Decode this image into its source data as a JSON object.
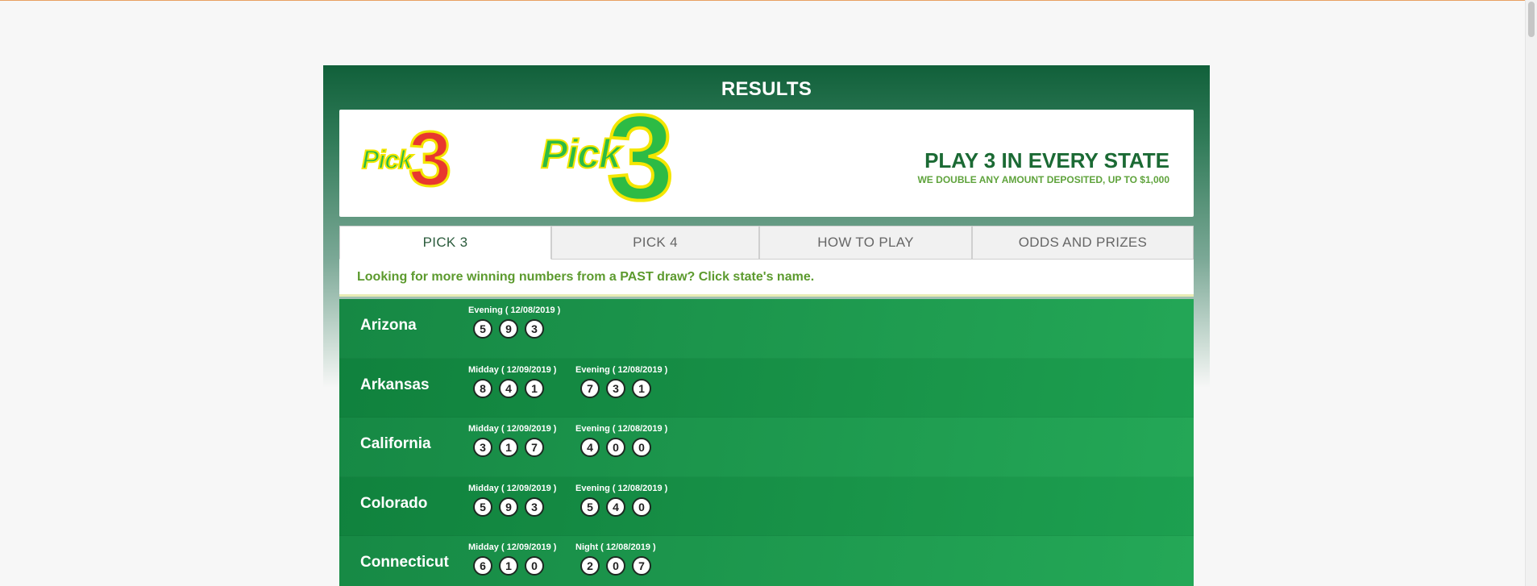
{
  "page": {
    "title": "RESULTS"
  },
  "banner": {
    "logo_small": {
      "pick": "Pick",
      "three": "3"
    },
    "logo_big": {
      "pick": "Pick",
      "three": "3"
    },
    "headline": "PLAY 3 IN EVERY STATE",
    "subline": "WE DOUBLE ANY AMOUNT DEPOSITED, UP TO $1,000"
  },
  "tabs": [
    {
      "label": "PICK 3",
      "active": true
    },
    {
      "label": "PICK 4",
      "active": false
    },
    {
      "label": "HOW TO PLAY",
      "active": false
    },
    {
      "label": "ODDS AND PRIZES",
      "active": false
    }
  ],
  "notice": "Looking for more winning numbers from a PAST draw? Click state's name.",
  "results": [
    {
      "state": "Arizona",
      "draws": [
        {
          "label": "Evening ( 12/08/2019 )",
          "numbers": [
            "5",
            "9",
            "3"
          ]
        }
      ]
    },
    {
      "state": "Arkansas",
      "draws": [
        {
          "label": "Midday ( 12/09/2019 )",
          "numbers": [
            "8",
            "4",
            "1"
          ]
        },
        {
          "label": "Evening ( 12/08/2019 )",
          "numbers": [
            "7",
            "3",
            "1"
          ]
        }
      ]
    },
    {
      "state": "California",
      "draws": [
        {
          "label": "Midday ( 12/09/2019 )",
          "numbers": [
            "3",
            "1",
            "7"
          ]
        },
        {
          "label": "Evening ( 12/08/2019 )",
          "numbers": [
            "4",
            "0",
            "0"
          ]
        }
      ]
    },
    {
      "state": "Colorado",
      "draws": [
        {
          "label": "Midday ( 12/09/2019 )",
          "numbers": [
            "5",
            "9",
            "3"
          ]
        },
        {
          "label": "Evening ( 12/08/2019 )",
          "numbers": [
            "5",
            "4",
            "0"
          ]
        }
      ]
    },
    {
      "state": "Connecticut",
      "draws": [
        {
          "label": "Midday ( 12/09/2019 )",
          "numbers": [
            "6",
            "1",
            "0"
          ]
        },
        {
          "label": "Night ( 12/08/2019 )",
          "numbers": [
            "2",
            "0",
            "7"
          ]
        }
      ]
    }
  ]
}
